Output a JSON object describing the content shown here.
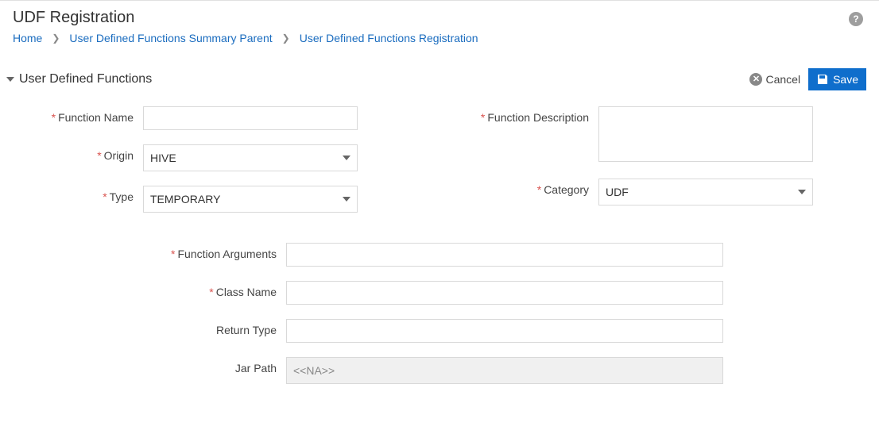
{
  "header": {
    "title": "UDF Registration"
  },
  "breadcrumbs": {
    "home": "Home",
    "summary": "User Defined Functions Summary Parent",
    "registration": "User Defined Functions Registration"
  },
  "section": {
    "title": "User Defined Functions"
  },
  "actions": {
    "cancel": "Cancel",
    "save": "Save"
  },
  "fields": {
    "function_name": {
      "label": "Function Name",
      "value": ""
    },
    "origin": {
      "label": "Origin",
      "value": "HIVE"
    },
    "type": {
      "label": "Type",
      "value": "TEMPORARY"
    },
    "function_description": {
      "label": "Function Description",
      "value": ""
    },
    "category": {
      "label": "Category",
      "value": "UDF"
    },
    "function_arguments": {
      "label": "Function Arguments",
      "value": ""
    },
    "class_name": {
      "label": "Class Name",
      "value": ""
    },
    "return_type": {
      "label": "Return Type",
      "value": ""
    },
    "jar_path": {
      "label": "Jar Path",
      "value": "<<NA>>"
    }
  }
}
